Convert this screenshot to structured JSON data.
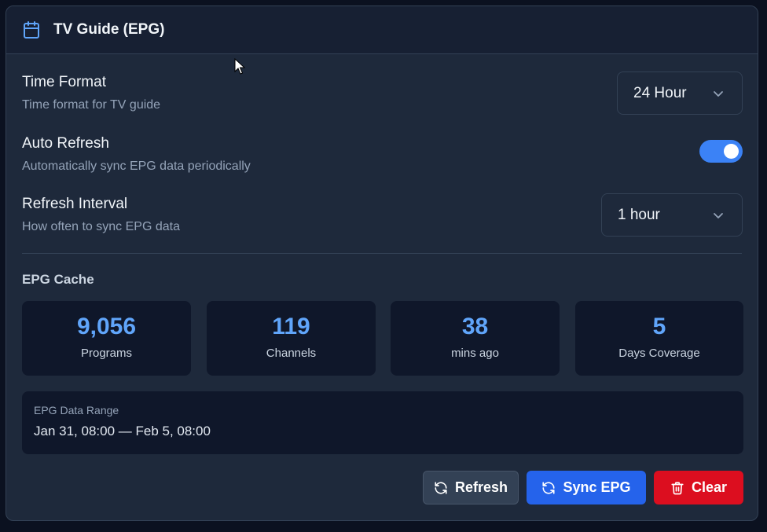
{
  "header": {
    "title": "TV Guide (EPG)",
    "icon": "calendar-icon"
  },
  "settings": {
    "time_format": {
      "title": "Time Format",
      "description": "Time format for TV guide",
      "value": "24 Hour"
    },
    "auto_refresh": {
      "title": "Auto Refresh",
      "description": "Automatically sync EPG data periodically",
      "enabled": true
    },
    "refresh_interval": {
      "title": "Refresh Interval",
      "description": "How often to sync EPG data",
      "value": "1 hour"
    }
  },
  "cache": {
    "title": "EPG Cache",
    "stats": [
      {
        "value": "9,056",
        "label": "Programs"
      },
      {
        "value": "119",
        "label": "Channels"
      },
      {
        "value": "38",
        "label": "mins ago"
      },
      {
        "value": "5",
        "label": "Days Coverage"
      }
    ],
    "range": {
      "label": "EPG Data Range",
      "value": "Jan 31, 08:00 — Feb 5, 08:00"
    }
  },
  "actions": {
    "refresh_label": "Refresh",
    "sync_label": "Sync EPG",
    "clear_label": "Clear"
  },
  "colors": {
    "accent": "#3b82f6",
    "stat_value": "#60a5fa",
    "danger": "#dc0e1f",
    "background": "#1e293b"
  }
}
